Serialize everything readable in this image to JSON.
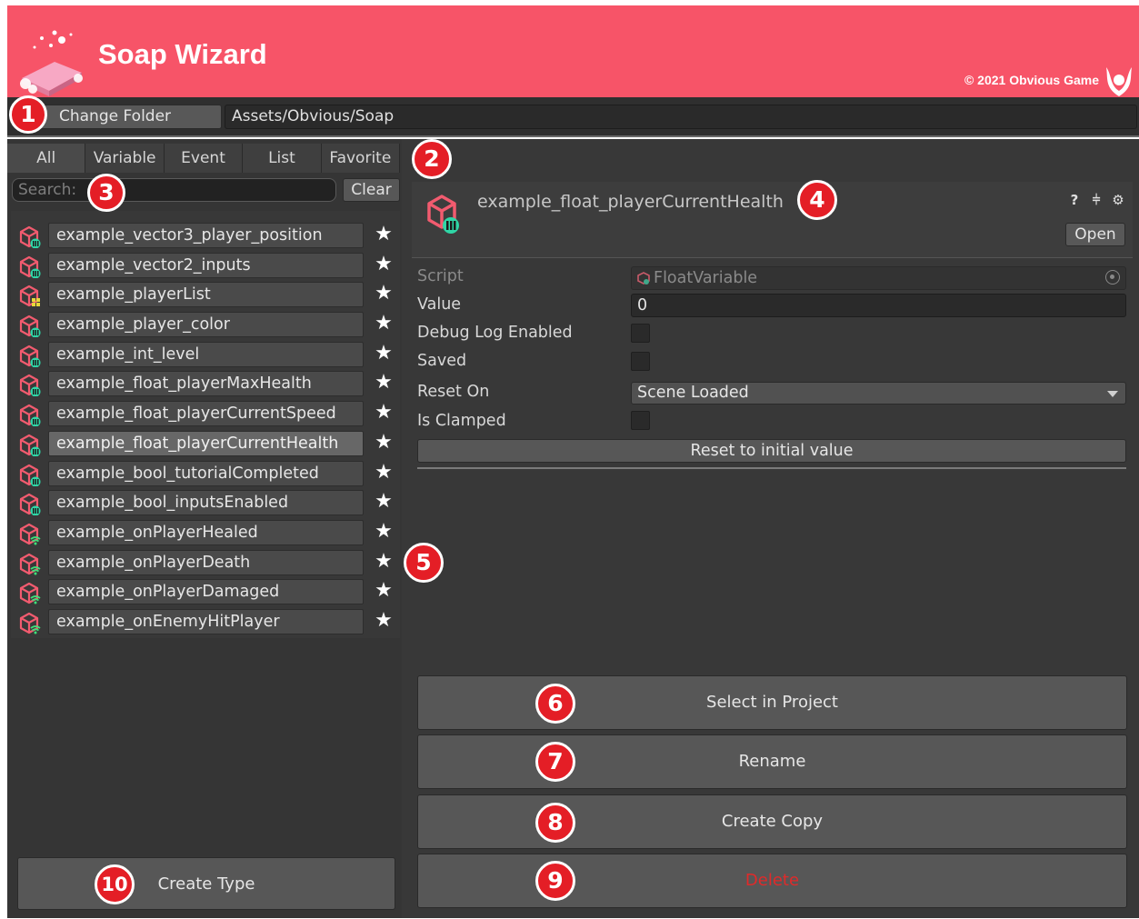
{
  "app": {
    "title": "Soap Wizard",
    "copyright": "© 2021 Obvious Game",
    "accent_color": "#f75468"
  },
  "toolbar": {
    "change_folder_label": "Change Folder",
    "folder_path": "Assets/Obvious/Soap"
  },
  "tabs": [
    {
      "label": "All",
      "active": true
    },
    {
      "label": "Variable",
      "active": false
    },
    {
      "label": "Event",
      "active": false
    },
    {
      "label": "List",
      "active": false
    },
    {
      "label": "Favorite",
      "active": false
    }
  ],
  "search": {
    "placeholder": "Search:",
    "clear_label": "Clear"
  },
  "assets": [
    {
      "name": "example_vector3_player_position",
      "icon": "variable-icon"
    },
    {
      "name": "example_vector2_inputs",
      "icon": "variable-icon"
    },
    {
      "name": "example_playerList",
      "icon": "list-icon"
    },
    {
      "name": "example_player_color",
      "icon": "variable-icon"
    },
    {
      "name": "example_int_level",
      "icon": "variable-icon"
    },
    {
      "name": "example_float_playerMaxHealth",
      "icon": "variable-icon"
    },
    {
      "name": "example_float_playerCurrentSpeed",
      "icon": "variable-icon"
    },
    {
      "name": "example_float_playerCurrentHealth",
      "icon": "variable-icon",
      "selected": true
    },
    {
      "name": "example_bool_tutorialCompleted",
      "icon": "variable-icon"
    },
    {
      "name": "example_bool_inputsEnabled",
      "icon": "variable-icon"
    },
    {
      "name": "example_onPlayerHealed",
      "icon": "event-icon"
    },
    {
      "name": "example_onPlayerDeath",
      "icon": "event-icon"
    },
    {
      "name": "example_onPlayerDamaged",
      "icon": "event-icon"
    },
    {
      "name": "example_onEnemyHitPlayer",
      "icon": "event-icon"
    }
  ],
  "create_type_label": "Create Type",
  "inspector": {
    "asset_name": "example_float_playerCurrentHealth",
    "open_label": "Open",
    "tool_icons": [
      "help-icon",
      "presets-icon",
      "gear-icon"
    ],
    "fields": {
      "script_label": "Script",
      "script_value": "FloatVariable",
      "value_label": "Value",
      "value": "0",
      "debug_label": "Debug Log Enabled",
      "debug_checked": false,
      "saved_label": "Saved",
      "saved_checked": false,
      "reset_on_label": "Reset On",
      "reset_on_value": "Scene Loaded",
      "clamped_label": "Is Clamped",
      "clamped_checked": false
    },
    "reset_label": "Reset to initial value"
  },
  "actions": {
    "select_label": "Select in Project",
    "rename_label": "Rename",
    "copy_label": "Create Copy",
    "delete_label": "Delete",
    "delete_color": "#e02a2a"
  },
  "callouts": [
    "1",
    "2",
    "3",
    "4",
    "5",
    "6",
    "7",
    "8",
    "9",
    "10"
  ]
}
